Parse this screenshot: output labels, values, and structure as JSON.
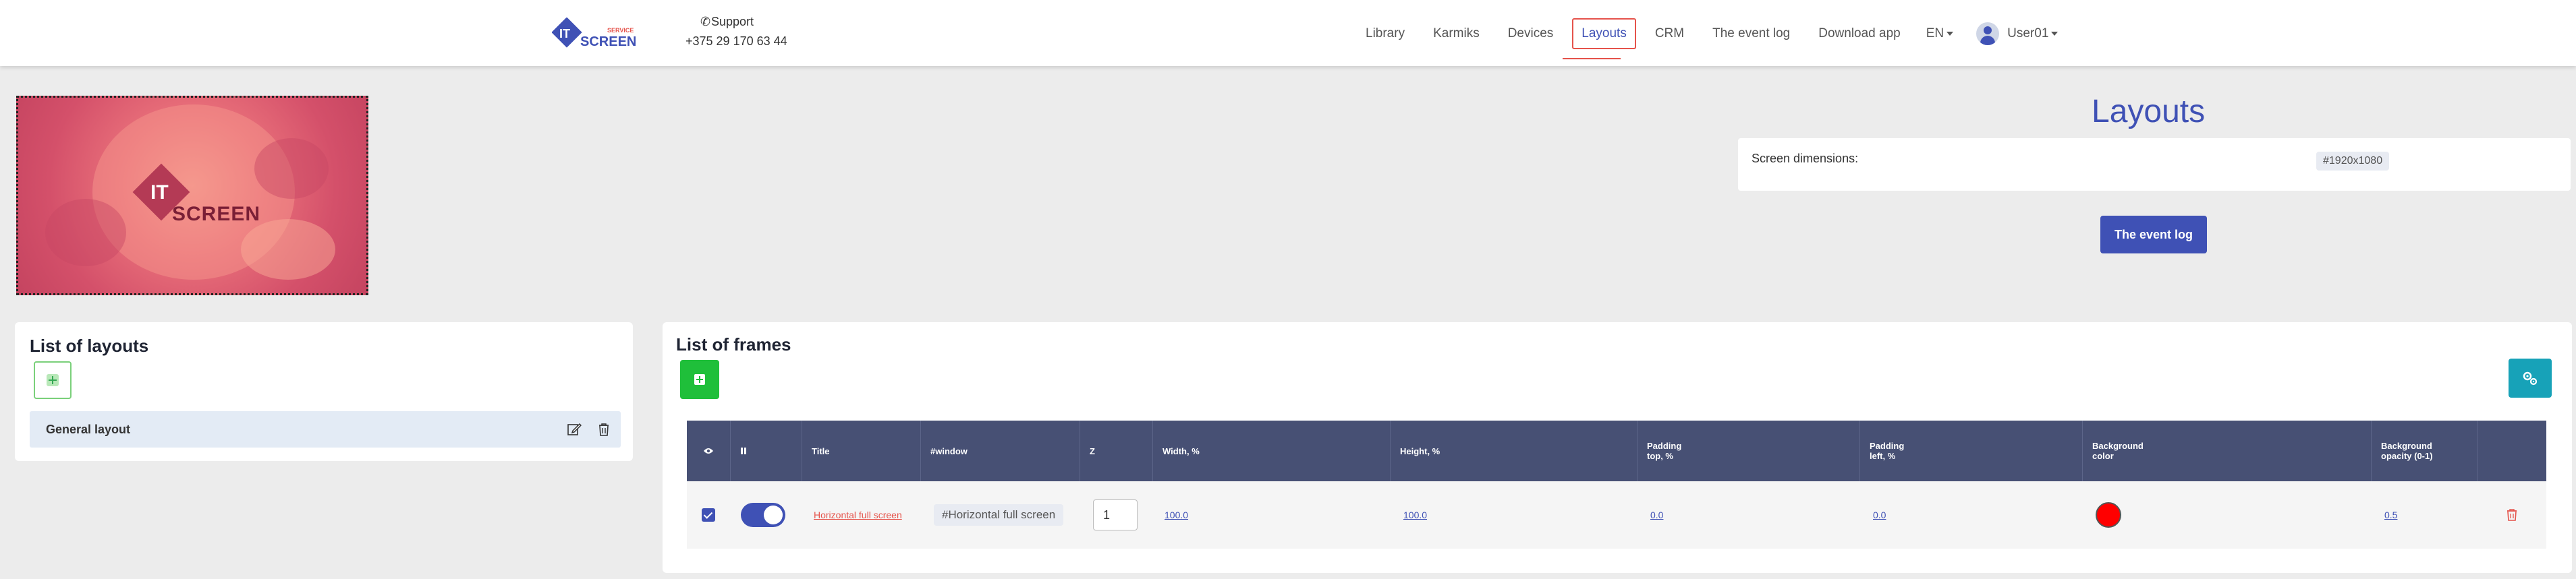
{
  "header": {
    "logo": {
      "it": "IT",
      "service": "SERVICE",
      "screen": "SCREEN"
    },
    "support": {
      "label": "Support",
      "phone": "+375 29 170 63 44"
    },
    "nav": [
      {
        "label": "Library"
      },
      {
        "label": "Karmiks"
      },
      {
        "label": "Devices"
      },
      {
        "label": "Layouts",
        "active": true
      },
      {
        "label": "CRM"
      },
      {
        "label": "The event log"
      },
      {
        "label": "Download app"
      }
    ],
    "language": "EN",
    "user": "User01"
  },
  "preview": {
    "logo_it": "IT",
    "logo_screen": "SCREEN"
  },
  "layouts_panel": {
    "title": "Layouts",
    "dimensions_label": "Screen dimensions:",
    "dimensions_value": "#1920x1080",
    "event_log_button": "The event log"
  },
  "layouts_list": {
    "title": "List of layouts",
    "items": [
      {
        "name": "General layout"
      }
    ]
  },
  "frames": {
    "title": "List of frames",
    "columns": [
      "#window",
      "Z",
      "Width, %",
      "Height, %",
      "Padding top, %",
      "Padding left, %",
      "Background color",
      "Background opacity (0-1)"
    ],
    "header_short": {
      "title": "Title"
    },
    "rows": [
      {
        "visible": true,
        "enabled": true,
        "title": "Horizontal full screen",
        "window": "#Horizontal full screen",
        "z": "1",
        "width": "100.0",
        "height": "100.0",
        "padding_top": "0.0",
        "padding_left": "0.0",
        "background_color": "#ff0000",
        "background_opacity": "0.5"
      }
    ]
  },
  "colors": {
    "accent": "#3f51b5",
    "danger": "#e5534b",
    "success": "#1fbf3a",
    "info": "#17a2b8",
    "table_header": "#475074"
  }
}
